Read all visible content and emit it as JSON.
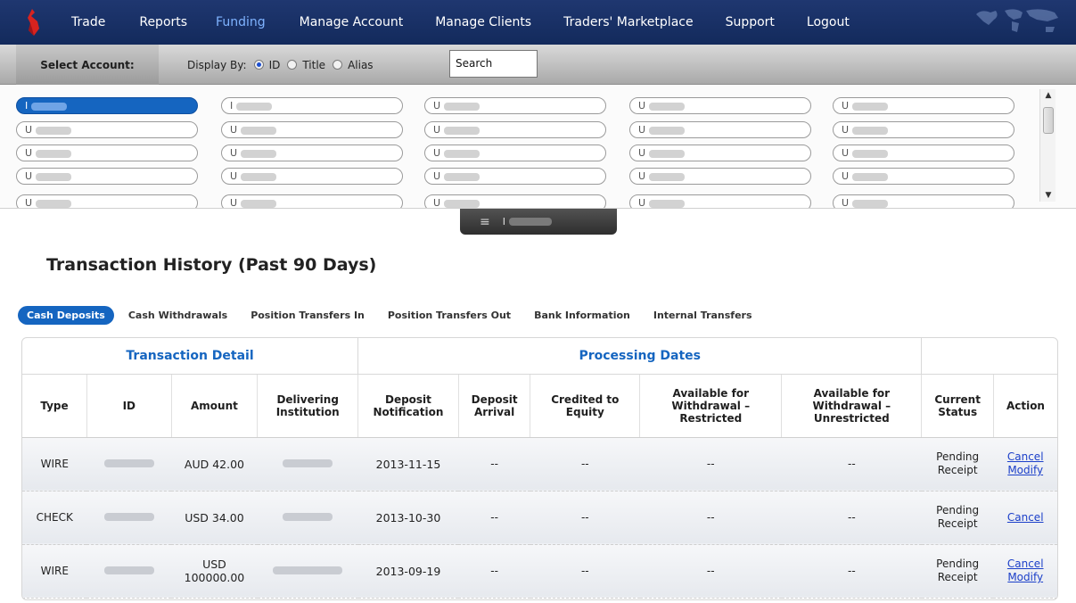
{
  "nav": {
    "items": [
      "Trade",
      "Reports",
      "Funding",
      "Manage Account",
      "Manage Clients",
      "Traders' Marketplace",
      "Support",
      "Logout"
    ],
    "active_index": 2
  },
  "account_bar": {
    "select_label": "Select Account:",
    "display_by_label": "Display By:",
    "options": [
      "ID",
      "Title",
      "Alias"
    ],
    "selected_option": "ID",
    "search_value": "Search"
  },
  "account_grid": {
    "rows": [
      [
        "I",
        "I",
        "U",
        "U",
        "U"
      ],
      [
        "U",
        "U",
        "U",
        "U",
        "U"
      ],
      [
        "U",
        "U",
        "U",
        "U",
        "U"
      ],
      [
        "U",
        "U",
        "U",
        "U",
        "U"
      ],
      [
        "U",
        "U",
        "U",
        "U",
        "U"
      ]
    ]
  },
  "collapse_tab": {
    "menu_glyph": "≡",
    "account_prefix": "I"
  },
  "page_title": "Transaction History (Past 90 Days)",
  "tabs": [
    "Cash Deposits",
    "Cash Withdrawals",
    "Position Transfers In",
    "Position Transfers Out",
    "Bank Information",
    "Internal Transfers"
  ],
  "active_tab": "Cash Deposits",
  "table": {
    "group_headers": {
      "transaction_detail": "Transaction Detail",
      "processing_dates": "Processing Dates"
    },
    "columns": [
      "Type",
      "ID",
      "Amount",
      "Delivering Institution",
      "Deposit Notification",
      "Deposit Arrival",
      "Credited to Equity",
      "Available for Withdrawal – Restricted",
      "Available for Withdrawal – Unrestricted",
      "Current Status",
      "Action"
    ],
    "rows": [
      {
        "type": "WIRE",
        "amount": "AUD 42.00",
        "notification": "2013-11-15",
        "arrival": "--",
        "credited": "--",
        "restricted": "--",
        "unrestricted": "--",
        "status": "Pending Receipt",
        "actions": [
          "Cancel",
          "Modify"
        ]
      },
      {
        "type": "CHECK",
        "amount": "USD 34.00",
        "notification": "2013-10-30",
        "arrival": "--",
        "credited": "--",
        "restricted": "--",
        "unrestricted": "--",
        "status": "Pending Receipt",
        "actions": [
          "Cancel"
        ]
      },
      {
        "type": "WIRE",
        "amount": "USD 100000.00",
        "notification": "2013-09-19",
        "arrival": "--",
        "credited": "--",
        "restricted": "--",
        "unrestricted": "--",
        "status": "Pending Receipt",
        "actions": [
          "Cancel",
          "Modify"
        ]
      }
    ]
  },
  "colors": {
    "nav_bg": "#1a3166",
    "accent": "#1565c0",
    "link": "#1b3fc9"
  }
}
